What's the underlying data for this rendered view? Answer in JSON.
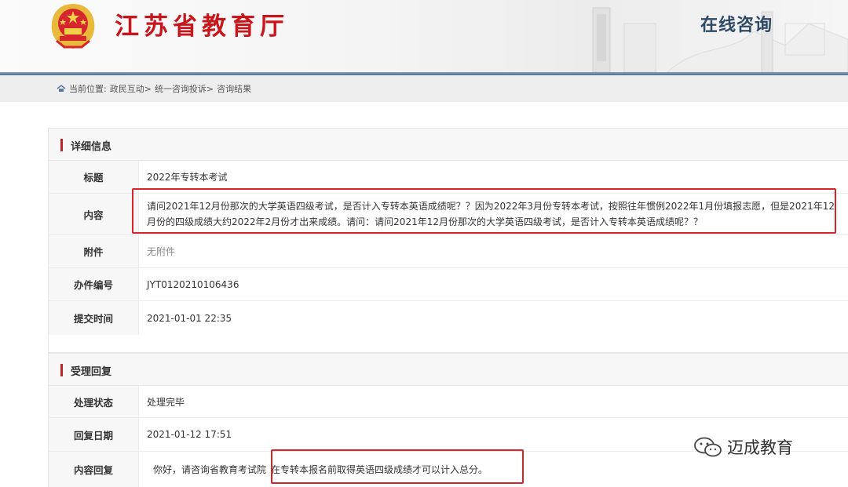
{
  "header": {
    "site_title": "江苏省教育厅",
    "consult_title": "在线咨询"
  },
  "breadcrumb": {
    "prefix": "当前位置:",
    "items": [
      "政民互动>",
      "统一咨询投诉>",
      "咨询结果"
    ]
  },
  "details": {
    "section_title": "详细信息",
    "rows": [
      {
        "label": "标题",
        "value": "2022年专转本考试"
      },
      {
        "label": "内容",
        "value": "请问2021年12月份那次的大学英语四级考试，是否计入专转本英语成绩呢？？因为2022年3月份专转本考试，按照往年惯例2022年1月份填报志愿，但是2021年12月份的四级成绩大约2022年2月份才出来成绩。请问：请问2021年12月份那次的大学英语四级考试，是否计入专转本英语成绩呢？？"
      },
      {
        "label": "附件",
        "value": "无附件"
      },
      {
        "label": "办件编号",
        "value": "JYT0120210106436"
      },
      {
        "label": "提交时间",
        "value": "2021-01-01 22:35"
      }
    ]
  },
  "reply": {
    "section_title": "受理回复",
    "rows": [
      {
        "label": "处理状态",
        "value": "处理完毕"
      },
      {
        "label": "回复日期",
        "value": "2021-01-12 17:51"
      },
      {
        "label": "内容回复",
        "value_part1": "你好，请咨询省教育考试院",
        "value_part2": "在专转本报名前取得英语四级成绩才可以计入总分。"
      }
    ]
  },
  "watermark": {
    "text": "迈成教育",
    "icon": "wechat-icon"
  },
  "colors": {
    "brand_red": "#c8161d",
    "highlight_red": "#d9232a",
    "title_blue": "#2f4a66"
  }
}
